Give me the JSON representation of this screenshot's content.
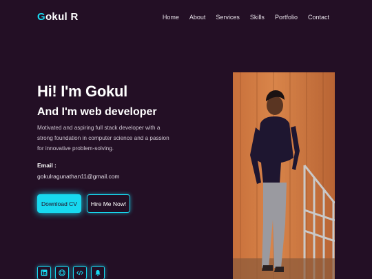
{
  "header": {
    "logo_first": "G",
    "logo_rest": "okul R",
    "nav": [
      "Home",
      "About",
      "Services",
      "Skills",
      "Portfolio",
      "Contact"
    ]
  },
  "hero": {
    "title": "Hi! I'm Gokul",
    "subtitle": "And I'm web developer",
    "description": "Motivated and aspiring full stack developer with a strong foundation in computer science and a passion for innovative problem-solving.",
    "email_label": "Email :",
    "email": "gokulragunathan11@gmail.com",
    "btn_cv": "Download CV",
    "btn_hire": "Hire Me Now!"
  },
  "socials": [
    "linkedin-icon",
    "github-icon",
    "code-icon",
    "bell-icon"
  ],
  "colors": {
    "background": "#230f25",
    "accent": "#18d9f0",
    "photo_bg": "#c8703b"
  }
}
